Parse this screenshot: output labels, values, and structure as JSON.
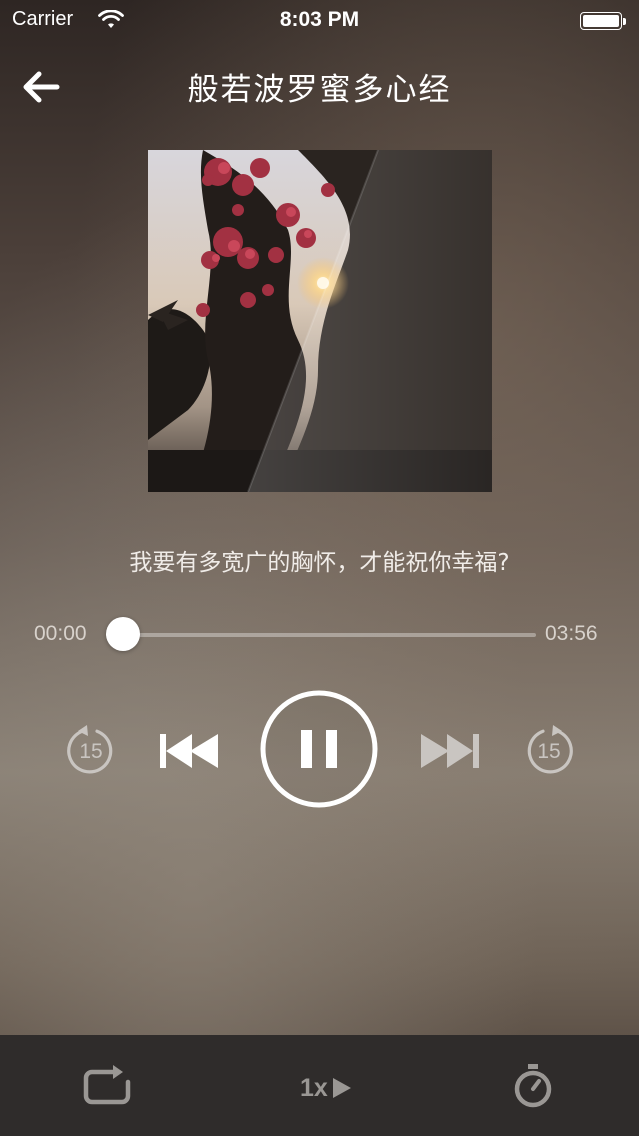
{
  "status_bar": {
    "carrier": "Carrier",
    "time": "8:03 PM"
  },
  "header": {
    "title": "般若波罗蜜多心经"
  },
  "now_playing": {
    "lyric": "我要有多宽广的胸怀，才能祝你幸福?"
  },
  "progress": {
    "elapsed": "00:00",
    "total": "03:56",
    "fraction": 0.0
  },
  "controls": {
    "skip_back_seconds": "15",
    "skip_forward_seconds": "15",
    "state": "playing"
  },
  "bottom_bar": {
    "speed_label": "1x"
  },
  "icons": {
    "back": "back-arrow-icon",
    "wifi": "wifi-icon",
    "battery": "battery-icon",
    "skip_back": "rewind-15-icon",
    "previous": "previous-track-icon",
    "pause": "pause-icon",
    "next": "next-track-icon",
    "skip_forward": "forward-15-icon",
    "repeat": "repeat-icon",
    "speed": "play-triangle-icon",
    "timer": "stopwatch-icon"
  },
  "colors": {
    "bottom_bar": "#2f2c2b",
    "inactive_icon": "#9a9794",
    "dim_control": "#c9c5c1"
  }
}
